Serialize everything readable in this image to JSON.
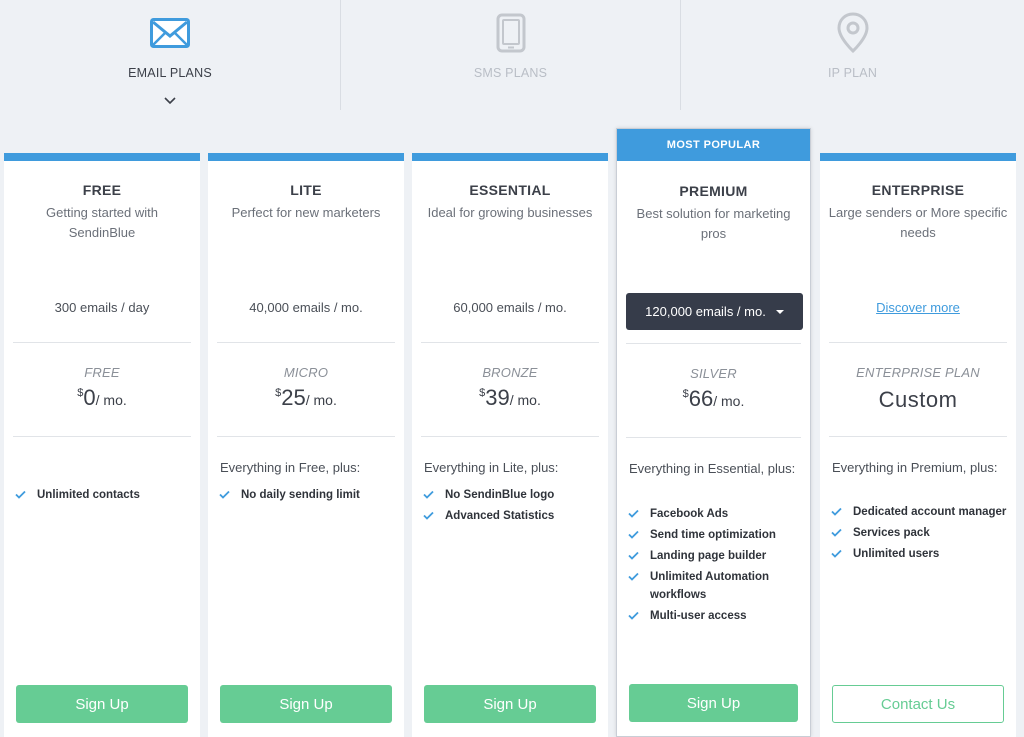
{
  "colors": {
    "accent": "#3f9bdd",
    "cta": "#66cc94",
    "dropdown": "#363c4a"
  },
  "tabs": [
    {
      "label": "EMAIL PLANS",
      "icon": "envelope-icon",
      "active": true
    },
    {
      "label": "SMS PLANS",
      "icon": "phone-icon",
      "active": false
    },
    {
      "label": "IP PLAN",
      "icon": "location-pin-icon",
      "active": false
    }
  ],
  "plans": [
    {
      "name": "FREE",
      "description": "Getting started with SendinBlue",
      "volume": "300 emails / day",
      "tier": "FREE",
      "currency": "$",
      "amount": "0",
      "period": "/ mo.",
      "includes": "",
      "features": [
        "Unlimited contacts"
      ],
      "cta": "Sign Up"
    },
    {
      "name": "LITE",
      "description": "Perfect for new marketers",
      "volume": "40,000 emails / mo.",
      "tier": "MICRO",
      "currency": "$",
      "amount": "25",
      "period": "/ mo.",
      "includes": "Everything in Free, plus:",
      "features": [
        "No daily sending limit"
      ],
      "cta": "Sign Up"
    },
    {
      "name": "ESSENTIAL",
      "description": "Ideal for growing businesses",
      "volume": "60,000 emails / mo.",
      "tier": "BRONZE",
      "currency": "$",
      "amount": "39",
      "period": "/ mo.",
      "includes": "Everything in Lite, plus:",
      "features": [
        "No SendinBlue logo",
        "Advanced Statistics"
      ],
      "cta": "Sign Up"
    },
    {
      "badge": "MOST POPULAR",
      "name": "PREMIUM",
      "description": "Best solution for marketing pros",
      "volume_selected": "120,000 emails / mo.",
      "tier": "SILVER",
      "currency": "$",
      "amount": "66",
      "period": "/ mo.",
      "includes": "Everything in Essential, plus:",
      "features": [
        "Facebook Ads",
        "Send time optimization",
        "Landing page builder",
        "Unlimited Automation workflows",
        "Multi-user access"
      ],
      "cta": "Sign Up"
    },
    {
      "name": "ENTERPRISE",
      "description": "Large senders or More specific needs",
      "link": "Discover more",
      "tier": "ENTERPRISE PLAN",
      "price_text": "Custom",
      "includes": "Everything in Premium, plus:",
      "features": [
        "Dedicated account manager",
        "Services pack",
        "Unlimited users"
      ],
      "cta": "Contact Us"
    }
  ]
}
